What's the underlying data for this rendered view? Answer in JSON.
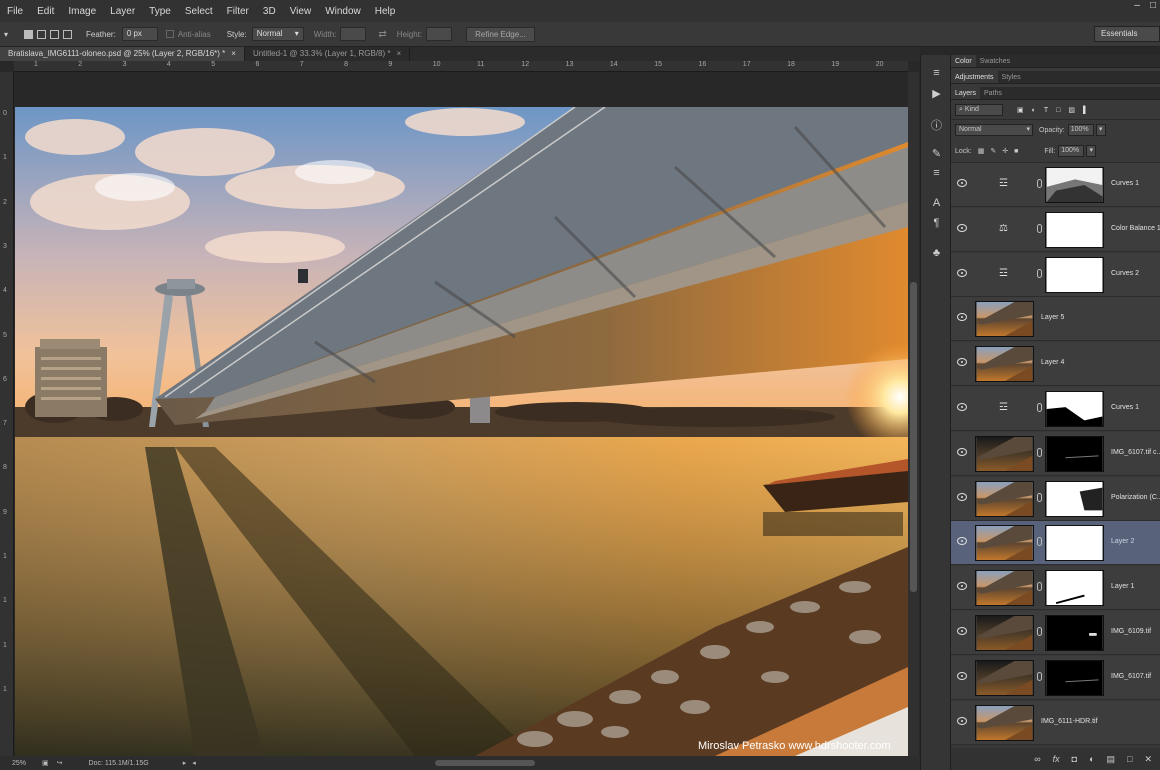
{
  "menu": [
    "File",
    "Edit",
    "Image",
    "Layer",
    "Type",
    "Select",
    "Filter",
    "3D",
    "View",
    "Window",
    "Help"
  ],
  "window_controls": [
    "minimize",
    "maximize"
  ],
  "options": {
    "feather_label": "Feather:",
    "feather_value": "0 px",
    "antialias_label": "Anti-alias",
    "style_label": "Style:",
    "style_value": "Normal",
    "width_label": "Width:",
    "height_label": "Height:",
    "refine_label": "Refine Edge...",
    "workspace": "Essentials"
  },
  "doc_tabs": [
    {
      "label": "Bratislava_IMG6111-oloneo.psd @ 25% (Layer 2, RGB/16*) *",
      "active": true
    },
    {
      "label": "Untitled-1 @ 33.3% (Layer 1, RGB/8) *",
      "active": false
    }
  ],
  "ruler_h": [
    "1",
    "2",
    "3",
    "4",
    "5",
    "6",
    "7",
    "8",
    "9",
    "10",
    "11",
    "12",
    "13",
    "14",
    "15",
    "16",
    "17",
    "18",
    "19",
    "20"
  ],
  "ruler_v": [
    "0",
    "1",
    "2",
    "3",
    "4",
    "5",
    "6",
    "7",
    "8",
    "9",
    "1",
    "1",
    "1",
    "1"
  ],
  "watermark": "Miroslav  Petrasko  www.hdrshooter.com",
  "status": {
    "zoom": "25%",
    "doc": "Doc: 115.1M/1.15G"
  },
  "panels": {
    "top_tabs": [
      "Color",
      "Swatches"
    ],
    "mid_tabs": [
      "Adjustments",
      "Styles"
    ],
    "layer_tabs": [
      "Layers",
      "Paths"
    ],
    "kind_label": "Kind",
    "blend_mode": "Normal",
    "opacity_label": "Opacity:",
    "opacity_value": "100%",
    "lock_label": "Lock:",
    "fill_label": "Fill:",
    "fill_value": "100%"
  },
  "layers": [
    {
      "name": "Curves 1",
      "type": "adjustment",
      "icon": "curves-icon",
      "mask": "curves-mask"
    },
    {
      "name": "Color Balance 1",
      "type": "adjustment",
      "icon": "balance-icon",
      "mask": "white"
    },
    {
      "name": "Curves 2",
      "type": "adjustment",
      "icon": "curves-icon",
      "mask": "white"
    },
    {
      "name": "Layer 5",
      "type": "pixel"
    },
    {
      "name": "Layer 4",
      "type": "pixel"
    },
    {
      "name": "Curves 1",
      "type": "adjustment",
      "icon": "curves-icon",
      "mask": "partial-white"
    },
    {
      "name": "IMG_6107.tif c...",
      "type": "pixel-mask",
      "thumb": "dark",
      "mask": "black-streak"
    },
    {
      "name": "Polarization (C...",
      "type": "pixel-mask",
      "mask": "white-dark"
    },
    {
      "name": "Layer 2",
      "type": "pixel-mask",
      "mask": "white",
      "selected": true
    },
    {
      "name": "Layer 1",
      "type": "pixel-mask",
      "mask": "white-line"
    },
    {
      "name": "IMG_6109.tif",
      "type": "pixel-mask",
      "thumb": "dark",
      "mask": "black-dot"
    },
    {
      "name": "IMG_6107.tif",
      "type": "pixel-mask",
      "thumb": "dark",
      "mask": "black-streak"
    },
    {
      "name": "IMG_6111-HDR.tif",
      "type": "pixel"
    }
  ]
}
